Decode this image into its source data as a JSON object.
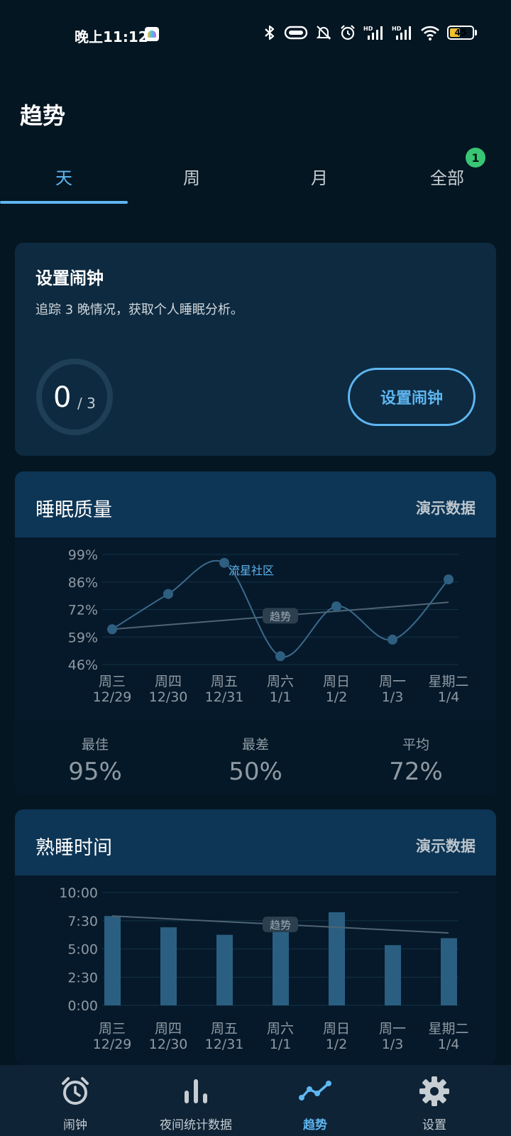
{
  "status": {
    "time": "晚上11:12",
    "battery": "45",
    "battery_level": 0.45,
    "icons": [
      "bluetooth-icon",
      "pill-icon",
      "bell-off-icon",
      "alarm-icon",
      "signal-hd-icon",
      "signal-hd-icon",
      "wifi-icon",
      "battery-icon"
    ]
  },
  "page": {
    "title": "趋势"
  },
  "tabs": [
    {
      "label": "天",
      "active": true
    },
    {
      "label": "周",
      "active": false
    },
    {
      "label": "月",
      "active": false
    },
    {
      "label": "全部",
      "active": false,
      "badge": "1"
    }
  ],
  "alarm_card": {
    "title": "设置闹钟",
    "description": "追踪 3 晚情况，获取个人睡眠分析。",
    "progress_current": "0",
    "progress_total": "/ 3",
    "button_label": "设置闹钟"
  },
  "quality_card": {
    "title": "睡眠质量",
    "demo_label": "演示数据",
    "watermark": "流星社区",
    "stats": [
      {
        "label": "最佳",
        "value": "95%"
      },
      {
        "label": "最差",
        "value": "50%"
      },
      {
        "label": "平均",
        "value": "72%"
      }
    ]
  },
  "sleep_card": {
    "title": "熟睡时间",
    "demo_label": "演示数据"
  },
  "chart_data": [
    {
      "type": "line",
      "title": "睡眠质量",
      "y_ticks": [
        "99%",
        "86%",
        "72%",
        "59%",
        "46%"
      ],
      "ylim": [
        46,
        99
      ],
      "x_labels": [
        [
          "周三",
          "12/29"
        ],
        [
          "周四",
          "12/30"
        ],
        [
          "周五",
          "12/31"
        ],
        [
          "周六",
          "1/1"
        ],
        [
          "周日",
          "1/2"
        ],
        [
          "周一",
          "1/3"
        ],
        [
          "星期二",
          "1/4"
        ]
      ],
      "values": [
        63,
        80,
        95,
        50,
        74,
        58,
        87
      ],
      "trend": {
        "label": "趋势",
        "start": 63,
        "end": 76
      },
      "grid": true
    },
    {
      "type": "bar",
      "title": "熟睡时间",
      "y_ticks": [
        "10:00",
        "7:30",
        "5:00",
        "2:30",
        "0:00"
      ],
      "ylim": [
        0,
        600
      ],
      "x_labels": [
        [
          "周三",
          "12/29"
        ],
        [
          "周四",
          "12/30"
        ],
        [
          "周五",
          "12/31"
        ],
        [
          "周六",
          "1/1"
        ],
        [
          "周日",
          "1/2"
        ],
        [
          "周一",
          "1/3"
        ],
        [
          "星期二",
          "1/4"
        ]
      ],
      "values": [
        475,
        415,
        375,
        390,
        495,
        320,
        357
      ],
      "trend": {
        "label": "趋势",
        "start": 475,
        "end": 385
      },
      "grid": true
    }
  ],
  "bottom_nav": [
    {
      "label": "闹钟",
      "icon": "alarm-clock-icon",
      "active": false
    },
    {
      "label": "夜间统计数据",
      "icon": "bar-chart-icon",
      "active": false
    },
    {
      "label": "趋势",
      "icon": "trend-line-icon",
      "active": true
    },
    {
      "label": "设置",
      "icon": "gear-icon",
      "active": false
    }
  ],
  "colors": {
    "background": "#041622",
    "accent": "#5fb6f1",
    "card": "#0d2a40",
    "card_header": "#0d3555",
    "badge": "#38c674",
    "chart_point": "#2e5f80",
    "bar": "#2a5f82"
  }
}
